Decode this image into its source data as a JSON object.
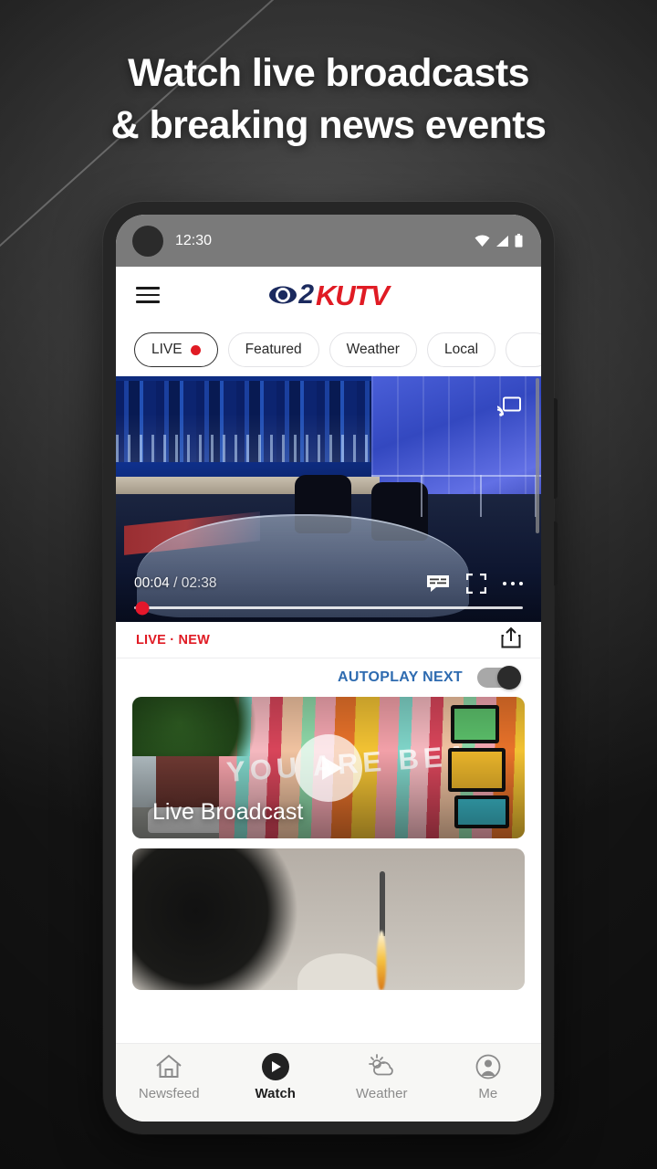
{
  "promo": {
    "headline_line1": "Watch live broadcasts",
    "headline_line2": "& breaking news events"
  },
  "phone": {
    "status_bar": {
      "time": "12:30",
      "icons": [
        "wifi-icon",
        "cellular-signal-icon",
        "battery-icon"
      ]
    }
  },
  "app": {
    "menu_icon": "hamburger-menu-icon",
    "logo": {
      "eye": "cbs-eye-icon",
      "channel_number": "2",
      "callsign": "KUTV",
      "navy": "#1b2a5e",
      "red": "#e01b24"
    },
    "chips": [
      {
        "label": "LIVE",
        "has_dot": true,
        "active": true
      },
      {
        "label": "Featured",
        "has_dot": false,
        "active": false
      },
      {
        "label": "Weather",
        "has_dot": false,
        "active": false
      },
      {
        "label": "Local",
        "has_dot": false,
        "active": false
      },
      {
        "label": "",
        "has_dot": false,
        "active": false
      }
    ],
    "player": {
      "cast_icon": "cast-icon",
      "current_time": "00:04",
      "separator": " / ",
      "total_time": "02:38",
      "cc_icon": "closed-caption-icon",
      "fullscreen_icon": "fullscreen-icon",
      "more_icon": "more-options-icon",
      "progress_percent": 2,
      "knob_color": "#e4172b"
    },
    "meta": {
      "live_label": "LIVE",
      "separator": "·",
      "new_label": "NEW",
      "share_icon": "share-icon",
      "accent_color": "#e01b24"
    },
    "autoplay": {
      "label": "AUTOPLAY NEXT",
      "enabled": true,
      "label_color": "#2e6bb0"
    },
    "cards": [
      {
        "title": "Live Broadcast",
        "has_play_button": true
      },
      {
        "title": "",
        "has_play_button": false
      }
    ],
    "bottom_nav": [
      {
        "label": "Newsfeed",
        "icon": "home-icon",
        "active": false
      },
      {
        "label": "Watch",
        "icon": "play-circle-icon",
        "active": true
      },
      {
        "label": "Weather",
        "icon": "sun-cloud-icon",
        "active": false
      },
      {
        "label": "Me",
        "icon": "person-circle-icon",
        "active": false
      }
    ]
  }
}
